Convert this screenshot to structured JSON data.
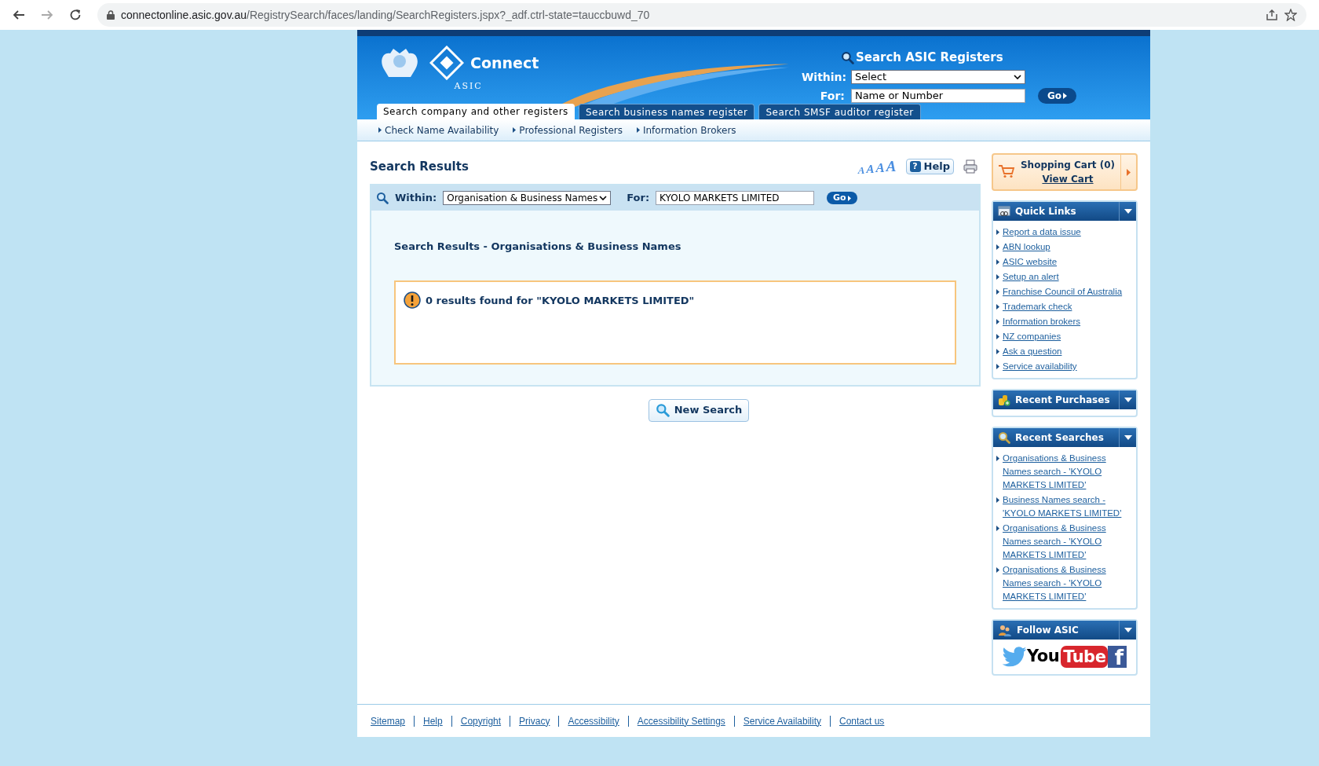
{
  "browser": {
    "url_host": "connectonline.asic.gov.au",
    "url_path": "/RegistrySearch/faces/landing/SearchRegisters.jspx?_adf.ctrl-state=tauccbuwd_70"
  },
  "header": {
    "brand": "Connect",
    "agency": "ASIC",
    "search_title": "Search ASIC Registers",
    "within_label": "Within:",
    "within_value": "Select",
    "for_label": "For:",
    "for_placeholder": "Name or Number",
    "go": "Go"
  },
  "tabs": [
    {
      "label": "Search company and other registers",
      "selected": true
    },
    {
      "label": "Search business names register",
      "selected": false
    },
    {
      "label": "Search SMSF auditor register",
      "selected": false
    }
  ],
  "subnav": [
    "Check Name Availability",
    "Professional Registers",
    "Information Brokers"
  ],
  "main": {
    "title": "Search Results",
    "font_sizes": [
      "A",
      "A",
      "A",
      "A"
    ],
    "help": "Help",
    "help_icon": "?",
    "within_label": "Within:",
    "within_value": "Organisation & Business Names",
    "for_label": "For:",
    "for_value": "KYOLO MARKETS LIMITED",
    "go": "Go",
    "results_heading": "Search Results - Organisations & Business Names",
    "message": "0 results found for \"KYOLO MARKETS LIMITED\"",
    "new_search": "New Search"
  },
  "cart": {
    "title": "Shopping Cart (0)",
    "link": "View Cart"
  },
  "panels": [
    {
      "kind": "links",
      "title": "Quick Links",
      "items": [
        "Report a data issue",
        "ABN lookup",
        "ASIC website",
        "Setup an alert",
        "Franchise Council of Australia",
        "Trademark check",
        "Information brokers",
        "NZ companies",
        "Ask a question",
        "Service availability"
      ]
    },
    {
      "kind": "purchases",
      "title": "Recent Purchases"
    },
    {
      "kind": "searches",
      "title": "Recent Searches",
      "items": [
        "Organisations & Business Names search - 'KYOLO MARKETS LIMITED'",
        "Business Names search - 'KYOLO MARKETS LIMITED'",
        "Organisations & Business Names search - 'KYOLO MARKETS LIMITED'",
        "Organisations & Business Names search - 'KYOLO MARKETS LIMITED'"
      ]
    },
    {
      "kind": "follow",
      "title": "Follow ASIC",
      "social": {
        "youtube": [
          "You",
          "Tube"
        ],
        "facebook": "f"
      }
    }
  ],
  "footer": [
    "Sitemap",
    "Help",
    "Copyright",
    "Privacy",
    "Accessibility",
    "Accessibility Settings",
    "Service Availability",
    "Contact us"
  ]
}
